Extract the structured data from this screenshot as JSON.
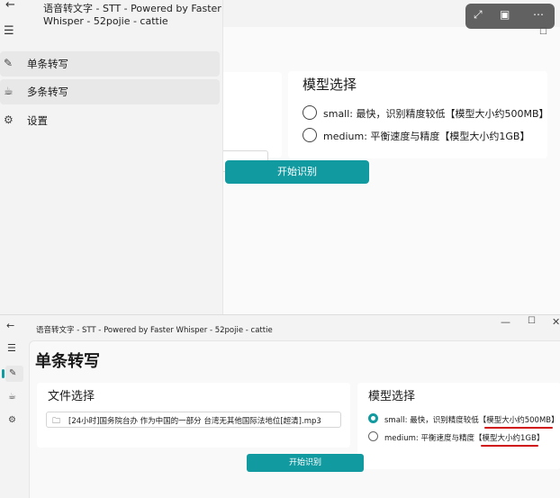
{
  "app": {
    "title": "语音转文字 - STT - Powered by Faster Whisper - 52pojie - cattie"
  },
  "top_screenshot": {
    "nav": [
      {
        "label": "单条转写",
        "icon": "edit-icon",
        "selected": true
      },
      {
        "label": "多条转写",
        "icon": "mug-icon",
        "selected": true
      },
      {
        "label": "设置",
        "icon": "gear-icon",
        "selected": false
      }
    ],
    "model_section_title": "模型选择",
    "options": [
      {
        "text": "small: 最快，识别精度较低【模型大小约500MB】",
        "selected": false
      },
      {
        "text": "medium: 平衡速度与精度【模型大小约1GB】",
        "selected": false
      }
    ],
    "start_button": "开始识别",
    "overlay_icons": [
      "expand-icon",
      "scan-text-icon",
      "more-icon"
    ]
  },
  "bottom_screenshot": {
    "page_title": "单条转写",
    "file_section_title": "文件选择",
    "file_name": "[24小时]国务院台办 作为中国的一部分 台湾无其他国际法地位[超清].mp3",
    "model_section_title": "模型选择",
    "options": [
      {
        "prefix": "small: 最快，识别精度较低【",
        "highlight": "模型大小约500MB",
        "suffix": "】",
        "selected": true
      },
      {
        "prefix": "medium: 平衡速度与精度【",
        "highlight": "模型大小约1GB",
        "suffix": "】",
        "selected": false
      }
    ],
    "start_button": "开始识别",
    "window_controls": {
      "minimize": "—",
      "maximize": "☐",
      "close": "✕"
    }
  },
  "colors": {
    "accent": "#129aa1",
    "highlight_underline": "#d01010",
    "nav_background": "#f3f3f3",
    "selected_item": "#e8e8e8"
  }
}
